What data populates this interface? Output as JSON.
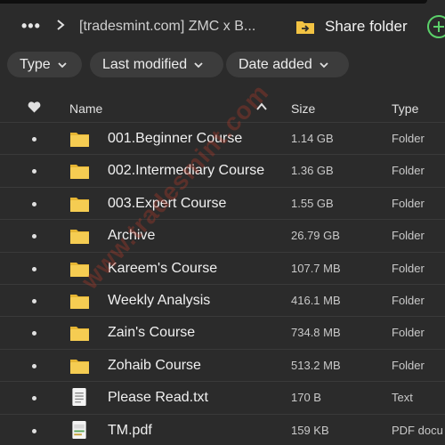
{
  "header": {
    "more_label": "•••",
    "breadcrumb": "[tradesmint.com] ZMC x B...",
    "share_label": "Share folder",
    "share_icon": "share-folder-icon",
    "add_icon": "add-circle-icon"
  },
  "filters": [
    {
      "label": "Type"
    },
    {
      "label": "Last modified"
    },
    {
      "label": "Date added"
    }
  ],
  "columns": {
    "favorite_icon": "heart-icon",
    "name": "Name",
    "size": "Size",
    "type": "Type",
    "sort": "ascending"
  },
  "rows": [
    {
      "name": "001.Beginner Course",
      "size": "1.14 GB",
      "type": "Folder",
      "icon": "folder-icon"
    },
    {
      "name": "002.Intermediary Course",
      "size": "1.36 GB",
      "type": "Folder",
      "icon": "folder-icon"
    },
    {
      "name": "003.Expert Course",
      "size": "1.55 GB",
      "type": "Folder",
      "icon": "folder-icon"
    },
    {
      "name": "Archive",
      "size": "26.79 GB",
      "type": "Folder",
      "icon": "folder-icon"
    },
    {
      "name": "Kareem's Course",
      "size": "107.7 MB",
      "type": "Folder",
      "icon": "folder-icon"
    },
    {
      "name": "Weekly Analysis",
      "size": "416.1 MB",
      "type": "Folder",
      "icon": "folder-icon"
    },
    {
      "name": "Zain's Course",
      "size": "734.8 MB",
      "type": "Folder",
      "icon": "folder-icon"
    },
    {
      "name": "Zohaib Course",
      "size": "513.2 MB",
      "type": "Folder",
      "icon": "folder-icon"
    },
    {
      "name": "Please Read.txt",
      "size": "170 B",
      "type": "Text",
      "icon": "text-file-icon"
    },
    {
      "name": "TM.pdf",
      "size": "159 KB",
      "type": "PDF docu",
      "icon": "pdf-file-icon"
    }
  ],
  "watermark": "www.tradesmint.com",
  "colors": {
    "background": "#2b2b2b",
    "folder": "#f2c343",
    "accent_green": "#5bd16a",
    "pill_bg": "#3c3c3c"
  }
}
